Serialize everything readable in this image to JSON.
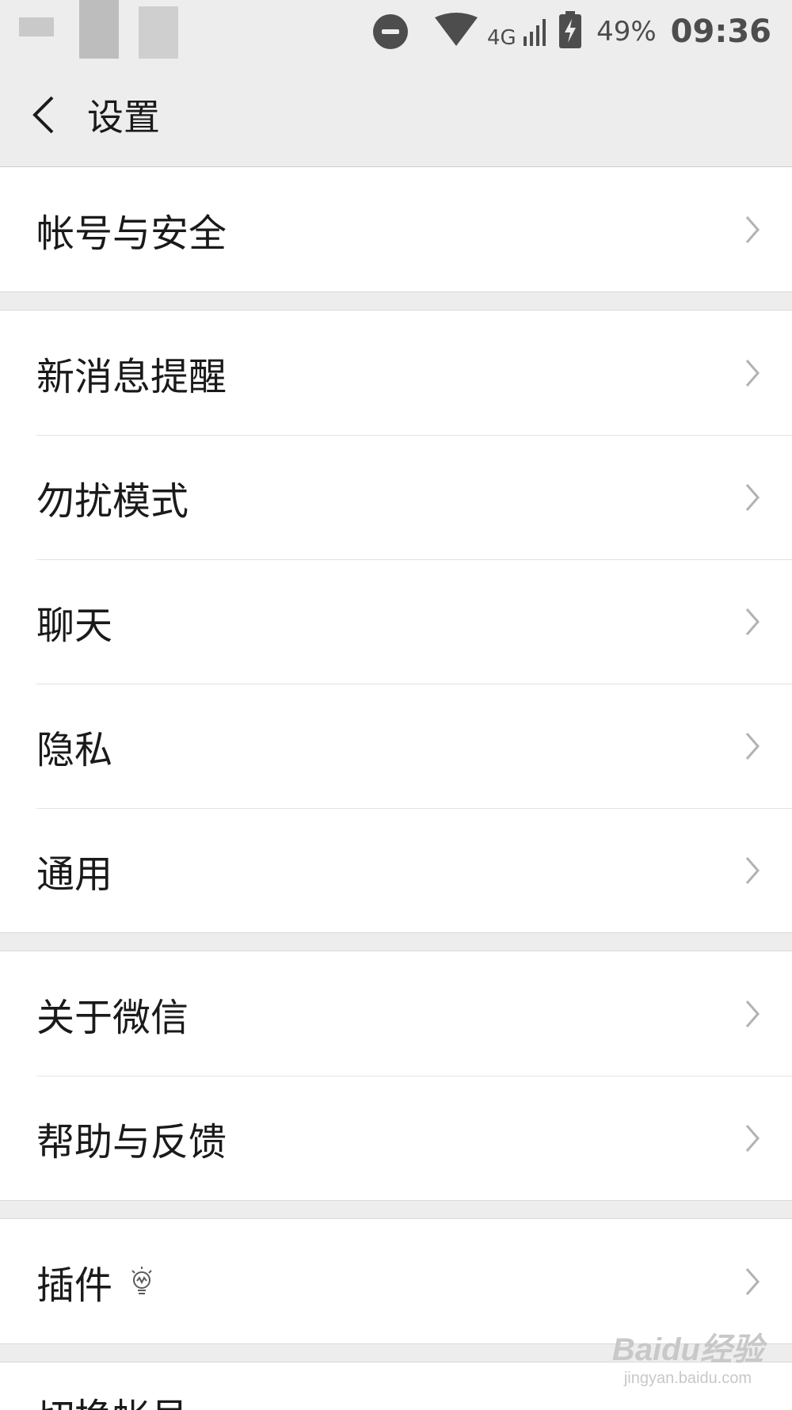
{
  "status_bar": {
    "battery_percent": "49%",
    "time": "09:36",
    "network": "4G"
  },
  "nav": {
    "title": "设置"
  },
  "groups": [
    {
      "items": [
        {
          "label": "帐号与安全"
        }
      ]
    },
    {
      "items": [
        {
          "label": "新消息提醒"
        },
        {
          "label": "勿扰模式"
        },
        {
          "label": "聊天"
        },
        {
          "label": "隐私"
        },
        {
          "label": "通用"
        }
      ]
    },
    {
      "items": [
        {
          "label": "关于微信"
        },
        {
          "label": "帮助与反馈"
        }
      ]
    },
    {
      "items": [
        {
          "label": "插件"
        }
      ]
    }
  ],
  "partial_item": {
    "label": "切换帐号"
  },
  "watermark": {
    "main": "Baidu经验",
    "sub": "jingyan.baidu.com"
  },
  "colors": {
    "background": "#ededed",
    "row": "#ffffff",
    "text": "#1a1a1a",
    "chevron": "#b2b2b2"
  }
}
